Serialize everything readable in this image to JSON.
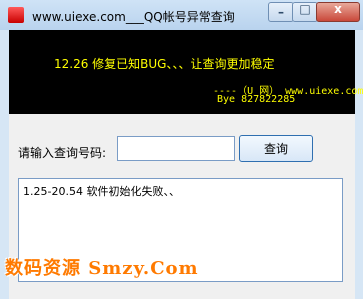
{
  "window": {
    "title": "www.uiexe.com___QQ帐号异常查询",
    "min_glyph": "–",
    "max_glyph": "□",
    "close_glyph": "x"
  },
  "banner": {
    "line1": "12.26 修复已知BUG、、、让查询更加稳定",
    "line2": "----（U 网） www.uiexe.com",
    "line3": "Bye 827822285"
  },
  "form": {
    "label": "请输入查询号码:",
    "input_value": "",
    "query_button": "查询"
  },
  "output": {
    "text": "1.25-20.54 软件初始化失败、、"
  },
  "watermark": {
    "text": "数码资源 Smzy.Com"
  }
}
